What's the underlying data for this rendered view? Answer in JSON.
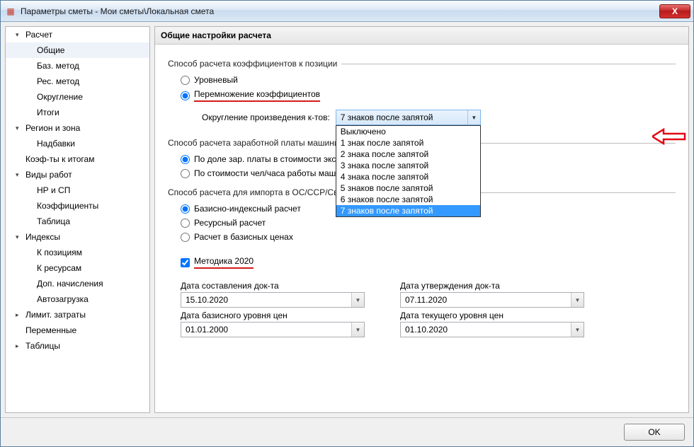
{
  "window": {
    "title": "Параметры сметы - Мои сметы\\Локальная смета",
    "close_label": "X"
  },
  "sidebar": {
    "items": [
      {
        "label": "Расчет",
        "level": 1,
        "caret": "down"
      },
      {
        "label": "Общие",
        "level": 2,
        "selected": true
      },
      {
        "label": "Баз. метод",
        "level": 2
      },
      {
        "label": "Рес. метод",
        "level": 2
      },
      {
        "label": "Округление",
        "level": 2
      },
      {
        "label": "Итоги",
        "level": 2
      },
      {
        "label": "Регион и зона",
        "level": 1,
        "caret": "down"
      },
      {
        "label": "Надбавки",
        "level": 2
      },
      {
        "label": "Коэф-ты к итогам",
        "level": 1,
        "caret": "none"
      },
      {
        "label": "Виды работ",
        "level": 1,
        "caret": "down"
      },
      {
        "label": "НР и СП",
        "level": 2
      },
      {
        "label": "Коэффициенты",
        "level": 2
      },
      {
        "label": "Таблица",
        "level": 2
      },
      {
        "label": "Индексы",
        "level": 1,
        "caret": "down"
      },
      {
        "label": "К позициям",
        "level": 2
      },
      {
        "label": "К ресурсам",
        "level": 2
      },
      {
        "label": "Доп. начисления",
        "level": 2
      },
      {
        "label": "Автозагрузка",
        "level": 2
      },
      {
        "label": "Лимит. затраты",
        "level": 1,
        "caret": "right"
      },
      {
        "label": "Переменные",
        "level": 1,
        "caret": "none"
      },
      {
        "label": "Таблицы",
        "level": 1,
        "caret": "right"
      }
    ]
  },
  "main": {
    "header": "Общие настройки расчета",
    "coef_group_label": "Способ расчета коэффициентов к позиции",
    "coef_options": {
      "level": "Уровневый",
      "multiply": "Перемножение коэффициентов"
    },
    "rounding_label": "Округление произведения к-тов:",
    "rounding_selected": "7 знаков после запятой",
    "rounding_options": [
      "Выключено",
      "1 знак после запятой",
      "2 знака после запятой",
      "3 знака после запятой",
      "4 знака после запятой",
      "5 знаков после запятой",
      "6 знаков после запятой",
      "7 знаков после запятой"
    ],
    "wage_group_label": "Способ расчета заработной платы машинистов",
    "wage_options": {
      "share": "По доле зар. платы в стоимости экспл",
      "hourly": "По стоимости чел/часа работы машин"
    },
    "import_group_label": "Способ расчета для импорта в ОС/ССР/Сводку затрат",
    "import_options": {
      "base_index": "Базисно-индексный расчет",
      "resource": "Ресурсный расчет",
      "base_price": "Расчет в базисных ценах"
    },
    "method2020_label": "Методика 2020",
    "dates": {
      "compose": {
        "label": "Дата составления док-та",
        "value": "15.10.2020"
      },
      "approve": {
        "label": "Дата утверждения док-та",
        "value": "07.11.2020"
      },
      "base": {
        "label": "Дата базисного уровня цен",
        "value": "01.01.2000"
      },
      "current": {
        "label": "Дата текущего уровня цен",
        "value": "01.10.2020"
      }
    }
  },
  "footer": {
    "ok": "OK"
  }
}
